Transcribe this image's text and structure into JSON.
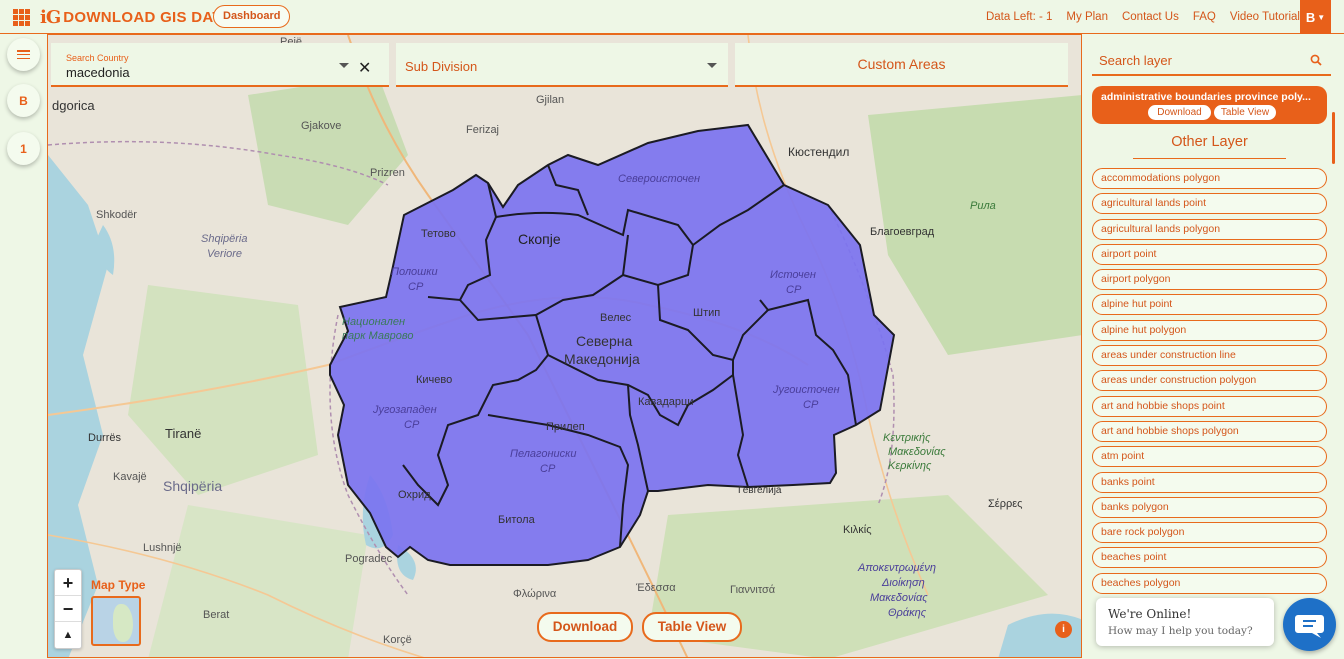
{
  "header": {
    "logo_mark": "iG",
    "logo_text": "DOWNLOAD GIS DATA",
    "dashboard_label": "Dashboard",
    "nav": {
      "data_left": "Data Left: - 1",
      "my_plan": "My Plan",
      "contact_us": "Contact Us",
      "faq": "FAQ",
      "video_tutorial": "Video Tutorial"
    },
    "user_initial": "B"
  },
  "rail": {
    "menu_icon": "hamburger-icon",
    "user_initial": "B",
    "counter": "1"
  },
  "controls": {
    "country_label": "Search Country",
    "country_value": "macedonia",
    "subdivision_label": "Sub Division",
    "custom_areas_label": "Custom Areas"
  },
  "map": {
    "map_type_label": "Map Type",
    "download_label": "Download",
    "table_view_label": "Table View",
    "info_label": "i",
    "labels": {
      "pejë": "Pejë",
      "gjilan": "Gjilan",
      "gjakove": "Gjakove",
      "ferizaj": "Ferizaj",
      "kyustendil": "Кюстендил",
      "podgorica": "dgorica",
      "prizren": "Prizren",
      "severoistochen": "Североисточен",
      "shkoder": "Shkodër",
      "tetovo": "Тетово",
      "skopje": "Скопје",
      "rila": "Рила",
      "blagoevgrad": "Благоевград",
      "shqiperia_veriore_1": "Shqipëria",
      "shqiperia_veriore_2": "Veriore",
      "poloshki_1": "Полошки",
      "poloshki_2": "СР",
      "istochen_1": "Источен",
      "istochen_2": "СР",
      "nacionalen_1": "Национален",
      "nacionalen_2": "парк Маврово",
      "veles": "Велес",
      "shtip": "Штип",
      "severna_1": "Северна",
      "severna_2": "Македонија",
      "kichevo": "Кичево",
      "jugoistochen_1": "Југоисточен",
      "jugoistochen_2": "СР",
      "jugozapaden_1": "Југозападен",
      "jugozapaden_2": "СР",
      "kavadarci": "Кавадарци",
      "durres": "Durrës",
      "tirane": "Tiranë",
      "prilep": "Прилеп",
      "pelagoniski_1": "Пелагониски",
      "pelagoniski_2": "СР",
      "kentriki_1": "Κεντρικής",
      "kentriki_2": "Μακεδονίας",
      "kentriki_3": "Κερκίνης",
      "kavaje": "Kavajë",
      "shqiperia": "Shqipëria",
      "ohrid": "Охрид",
      "gevgelija": "Гевгелија",
      "serres": "Σέρρες",
      "bitola": "Битола",
      "lushnje": "Lushnjë",
      "kilkis": "Κιλκίς",
      "pogradec": "Pogradec",
      "florina": "Φλώρινα",
      "edessa": "Έδεσσα",
      "giannitsa": "Γιαννιτσά",
      "apokentr_1": "Αποκεντρωμένη",
      "apokentr_2": "Διοίκηση",
      "apokentr_3": "Μακεδονίας",
      "apokentr_4": "Θράκης",
      "berat": "Berat",
      "korce": "Korçë"
    }
  },
  "panel": {
    "search_placeholder": "Search layer",
    "active_layer": "administrative boundaries province poly...",
    "active_download": "Download",
    "active_table_view": "Table View",
    "other_layer_title": "Other Layer",
    "layers": [
      "accommodations polygon",
      "agricultural lands point",
      "agricultural lands polygon",
      "airport point",
      "airport polygon",
      "alpine hut point",
      "alpine hut polygon",
      "areas under construction line",
      "areas under construction polygon",
      "art and hobbie shops point",
      "art and hobbie shops polygon",
      "atm point",
      "banks point",
      "banks polygon",
      "bare rock polygon",
      "beaches point",
      "beaches polygon"
    ]
  },
  "chat": {
    "title": "We're Online!",
    "subtitle": "How may I help you today?"
  },
  "colors": {
    "accent": "#e8601a",
    "background": "#eef7e6",
    "region_fill": "#7b73f0",
    "chat_blue": "#1e70c7"
  }
}
